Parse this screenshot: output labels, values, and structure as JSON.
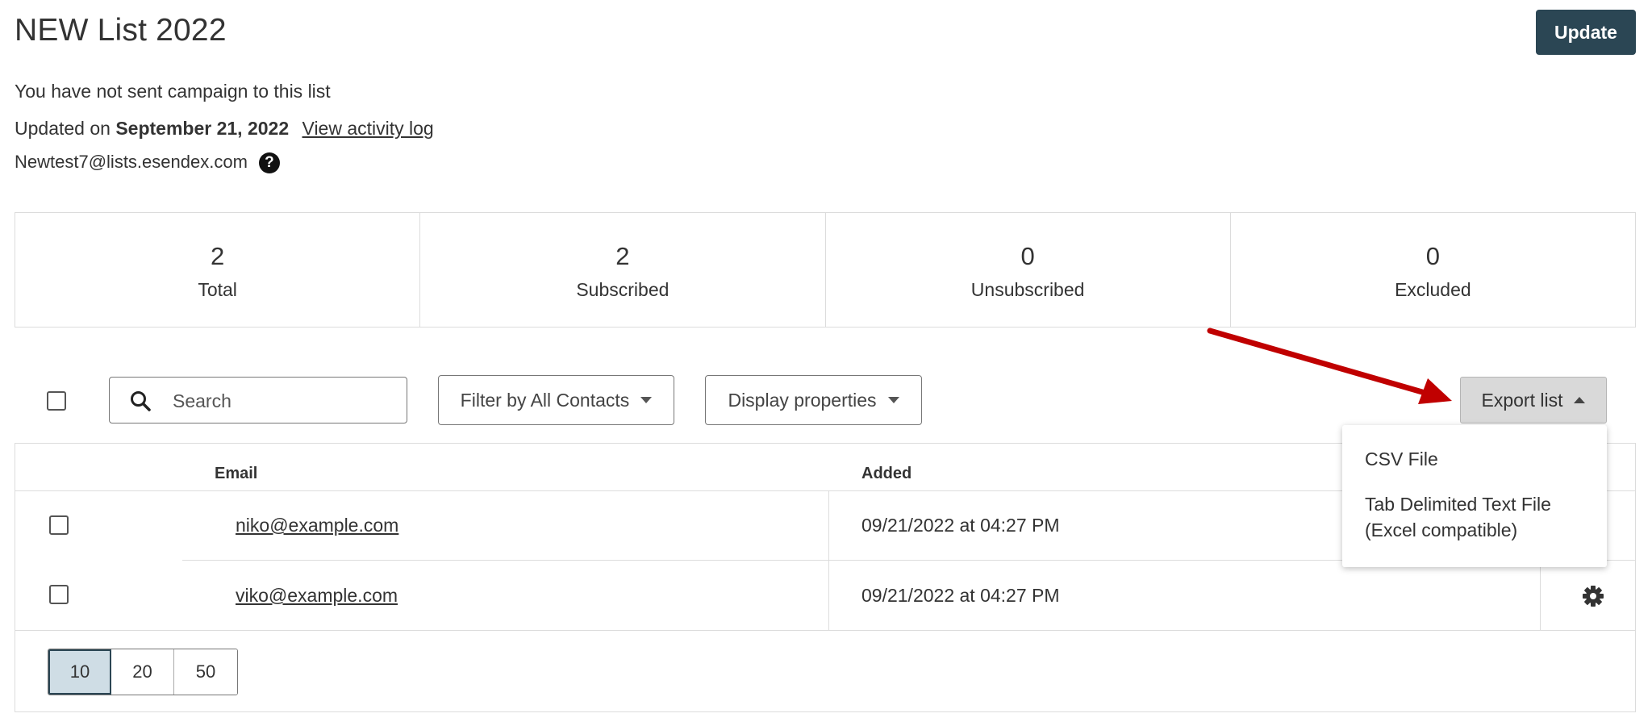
{
  "page": {
    "title": "NEW List 2022"
  },
  "header": {
    "update_label": "Update"
  },
  "info": {
    "campaign_status": "You have not sent campaign to this list",
    "updated_prefix": "Updated on",
    "updated_date": "September 21, 2022",
    "activity_link": "View activity log",
    "list_email": "Newtest7@lists.esendex.com",
    "help_glyph": "?"
  },
  "stats": [
    {
      "value": "2",
      "label": "Total"
    },
    {
      "value": "2",
      "label": "Subscribed"
    },
    {
      "value": "0",
      "label": "Unsubscribed"
    },
    {
      "value": "0",
      "label": "Excluded"
    }
  ],
  "toolbar": {
    "search_placeholder": "Search",
    "filter_label": "Filter by All Contacts",
    "display_label": "Display properties",
    "export_label": "Export list"
  },
  "export_menu": {
    "items": [
      "CSV File",
      "Tab Delimited Text File\n(Excel compatible)"
    ]
  },
  "table": {
    "headers": {
      "email": "Email",
      "added": "Added"
    },
    "rows": [
      {
        "email": "niko@example.com",
        "added": "09/21/2022 at 04:27 PM"
      },
      {
        "email": "viko@example.com",
        "added": "09/21/2022 at 04:27 PM"
      }
    ]
  },
  "pagination": {
    "sizes": [
      "10",
      "20",
      "50"
    ],
    "active": "10"
  },
  "colors": {
    "primary": "#2b4654",
    "annotation_arrow": "#c00000",
    "export_bg": "#d9d9d9"
  },
  "icons": {
    "search": "search-icon",
    "settings": "gear-icon",
    "help": "help-icon"
  }
}
